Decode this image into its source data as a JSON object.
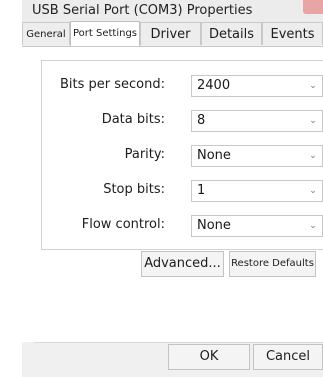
{
  "window": {
    "title": "USB Serial Port (COM3)  Properties"
  },
  "tabs": [
    {
      "label": "General"
    },
    {
      "label": "Port Settings"
    },
    {
      "label": "Driver"
    },
    {
      "label": "Details"
    },
    {
      "label": "Events"
    }
  ],
  "settings": {
    "bits_per_second": {
      "label": "Bits per second:",
      "value": "2400"
    },
    "data_bits": {
      "label": "Data bits:",
      "value": "8"
    },
    "parity": {
      "label": "Parity:",
      "value": "None"
    },
    "stop_bits": {
      "label": "Stop bits:",
      "value": "1"
    },
    "flow_control": {
      "label": "Flow control:",
      "value": "None"
    }
  },
  "buttons": {
    "advanced": "Advanced...",
    "restore_defaults": "Restore Defaults",
    "ok": "OK",
    "cancel": "Cancel"
  }
}
